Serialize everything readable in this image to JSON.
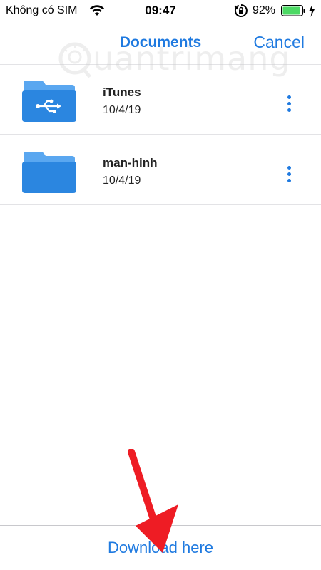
{
  "status": {
    "carrier": "Không có SIM",
    "time": "09:47",
    "battery_pct": "92%",
    "battery_level": 0.92,
    "icons": [
      "wifi-icon",
      "orientation-lock-icon",
      "battery-icon",
      "charging-bolt-icon"
    ]
  },
  "nav": {
    "title": "Documents",
    "cancel_label": "Cancel"
  },
  "watermark": {
    "text": "uantrimang"
  },
  "files": [
    {
      "name": "iTunes",
      "date": "10/4/19",
      "icon": "folder-usb-icon"
    },
    {
      "name": "man-hinh",
      "date": "10/4/19",
      "icon": "folder-icon"
    }
  ],
  "footer": {
    "download_label": "Download here"
  },
  "colors": {
    "accent": "#1f7ae0",
    "folder": "#2b86e0",
    "folder_tab": "#5aa7f0",
    "arrow": "#ee1c24",
    "battery": "#4cd964"
  }
}
